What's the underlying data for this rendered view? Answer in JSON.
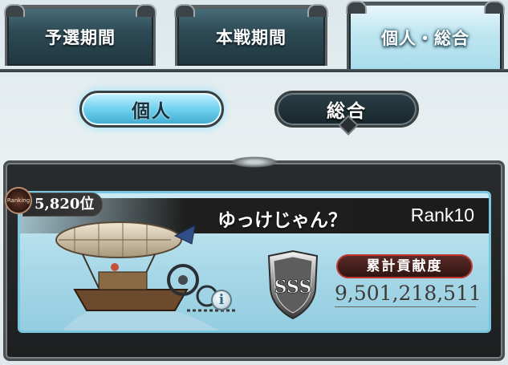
{
  "tabs": [
    {
      "label": "予選期間",
      "active": false
    },
    {
      "label": "本戦期間",
      "active": false
    },
    {
      "label": "個人・総合",
      "active": true
    }
  ],
  "sub_tabs": [
    {
      "label": "個人",
      "active": true
    },
    {
      "label": "総合",
      "active": false
    }
  ],
  "player": {
    "position": "5,820位",
    "badge_label": "Ranking",
    "name": "ゆっけじゃん？",
    "rank": "Rank10",
    "grade": "SSS",
    "stat_label": "累計貢献度",
    "contribution": "9,501,218,511"
  },
  "colors": {
    "active_tab": "#a7dcec",
    "active_subtab": "#6ed1ee",
    "stat_label_border": "#c3352c"
  }
}
